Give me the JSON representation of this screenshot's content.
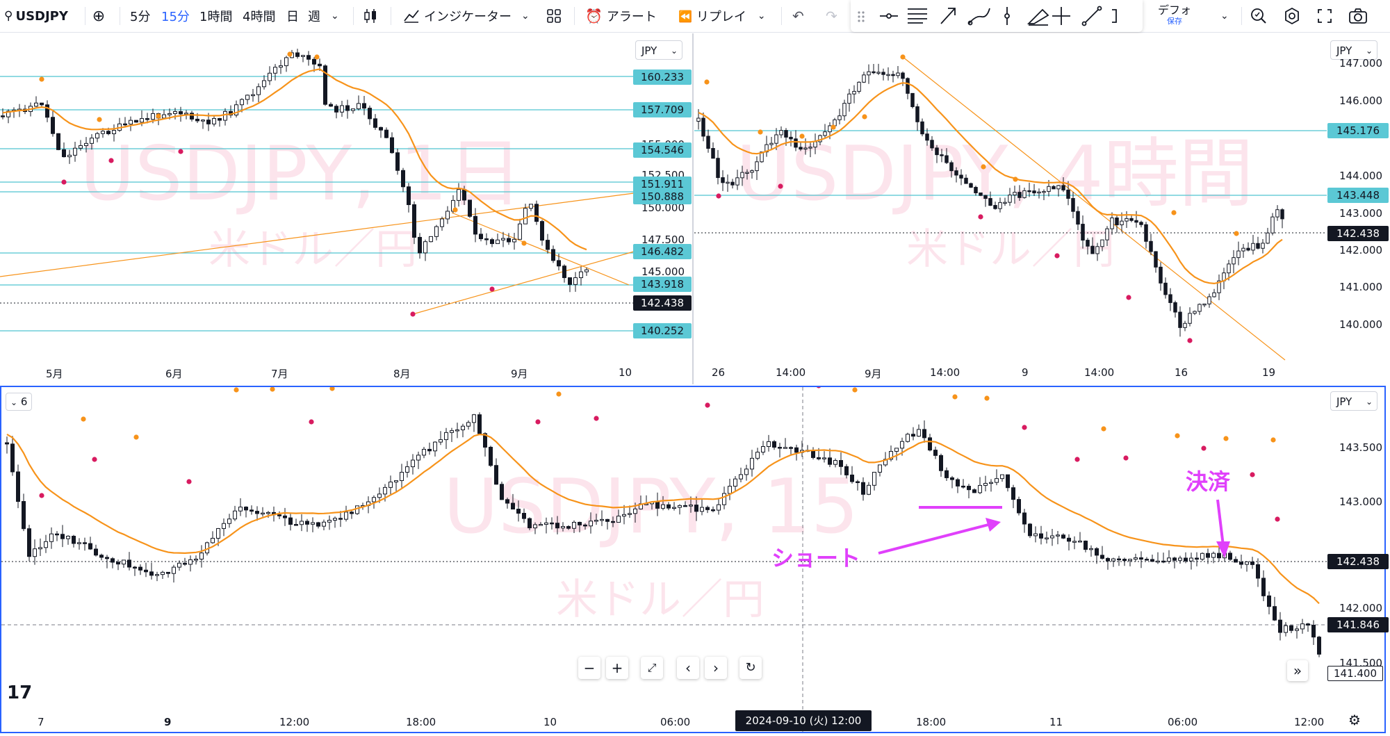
{
  "toolbar": {
    "symbol": "USDJPY",
    "intervals": [
      "5分",
      "15分",
      "1時間",
      "4時間",
      "日",
      "週"
    ],
    "active_interval": "15分",
    "indicators_label": "インジケーター",
    "alert_label": "アラート",
    "replay_label": "リプレイ",
    "layout_label": "デフォ",
    "layout_sub": "保存"
  },
  "colors": {
    "accent": "#2962ff",
    "candle_up": "#ffffff",
    "candle_down": "#131722",
    "baseline": "#f7931a",
    "hline": "#4fc3d0",
    "marker_high": "#f7931a",
    "marker_low": "#d81b60",
    "annotation": "#e040fb",
    "watermark": "#e91e63"
  },
  "pane_daily": {
    "watermark": "USDJPY, 1日",
    "subtitle": "米ドル／円",
    "currency": "JPY",
    "price_labels_highlight": [
      "160.233",
      "157.709",
      "154.546",
      "151.911",
      "150.888",
      "146.482",
      "143.918",
      "140.252"
    ],
    "price_ticks": [
      "155.000",
      "152.500",
      "150.000",
      "147.500",
      "145.000"
    ],
    "current_price": "142.438",
    "time_labels": [
      "5月",
      "6月",
      "7月",
      "8月",
      "9月",
      "10"
    ]
  },
  "pane_4h": {
    "watermark": "USDJPY, 4時間",
    "subtitle": "米ドル／円",
    "currency": "JPY",
    "price_ticks": [
      "147.000",
      "146.000",
      "144.000",
      "143.000",
      "142.000",
      "141.000",
      "140.000"
    ],
    "price_labels_highlight": [
      "145.176",
      "143.448"
    ],
    "current_price": "142.438",
    "time_labels": [
      "26",
      "14:00",
      "9月",
      "14:00",
      "9",
      "14:00",
      "16",
      "19"
    ]
  },
  "pane_15m": {
    "watermark": "USDJPY, 15",
    "subtitle": "米ドル／円",
    "currency": "JPY",
    "collapse_count": "6",
    "price_ticks": [
      "143.500",
      "143.000",
      "142.500",
      "142.000",
      "141.500"
    ],
    "current_price": "142.438",
    "crosshair_price": "141.846",
    "last_price": "141.400",
    "crosshair_time": "2024-09-10 (火)  12:00",
    "time_labels": [
      "7",
      "9",
      "12:00",
      "18:00",
      "10",
      "06:00",
      "18:00",
      "11",
      "06:00",
      "12:00"
    ],
    "annotations": {
      "short": "ショート",
      "exit": "決済"
    }
  },
  "chart_data": [
    {
      "type": "line",
      "title": "USDJPY, 1日",
      "x": [
        "5月",
        "6月",
        "7月",
        "8月",
        "9月",
        "10"
      ],
      "ylim": [
        139,
        162
      ],
      "series": [
        {
          "values": [
            153.5,
            156.0,
            157.5,
            161.5,
            150.0,
            144.5,
            146.0,
            142.4
          ]
        }
      ]
    },
    {
      "type": "line",
      "title": "USDJPY, 4時間",
      "x": [
        "26",
        "14:00",
        "9月",
        "14:00",
        "9",
        "14:00",
        "16",
        "19"
      ],
      "ylim": [
        139.5,
        147.0
      ],
      "series": [
        {
          "values": [
            144.5,
            145.5,
            147.0,
            145.0,
            142.5,
            143.0,
            140.0,
            143.4,
            142.4
          ]
        }
      ]
    },
    {
      "type": "line",
      "title": "USDJPY, 15",
      "x": [
        "7",
        "9",
        "12:00",
        "18:00",
        "10",
        "06:00",
        "18:00",
        "11",
        "06:00",
        "12:00"
      ],
      "ylim": [
        141.3,
        143.8
      ],
      "series": [
        {
          "values": [
            143.4,
            142.5,
            142.2,
            142.7,
            143.7,
            142.9,
            142.8,
            143.4,
            143.1,
            143.7,
            142.8,
            142.4,
            142.4,
            141.4
          ]
        }
      ]
    }
  ]
}
